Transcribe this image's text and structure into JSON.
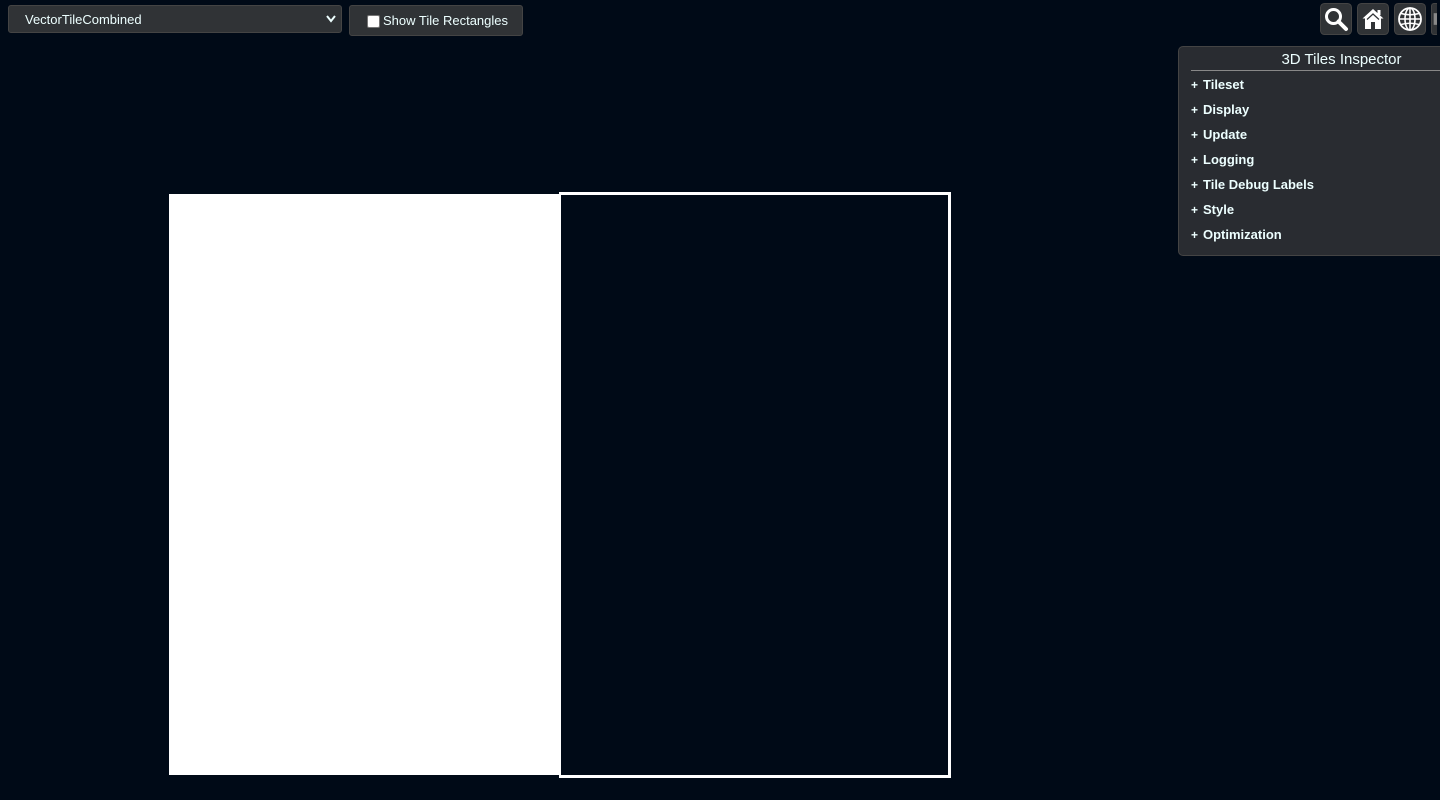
{
  "toolbar": {
    "selected_tileset": "VectorTileCombined",
    "checkbox_label": "Show Tile Rectangles",
    "checkbox_checked": false
  },
  "top_buttons": [
    {
      "name": "search-button",
      "icon": "search-icon"
    },
    {
      "name": "home-button",
      "icon": "home-icon"
    },
    {
      "name": "scene-mode-button",
      "icon": "globe-icon"
    }
  ],
  "inspector": {
    "title": "3D Tiles Inspector",
    "sections": [
      {
        "toggle": "+",
        "label": "Tileset"
      },
      {
        "toggle": "+",
        "label": "Display"
      },
      {
        "toggle": "+",
        "label": "Update"
      },
      {
        "toggle": "+",
        "label": "Logging"
      },
      {
        "toggle": "+",
        "label": "Tile Debug Labels"
      },
      {
        "toggle": "+",
        "label": "Style"
      },
      {
        "toggle": "+",
        "label": "Optimization"
      }
    ]
  },
  "colors": {
    "background": "#000a17",
    "panel": "#303336",
    "text": "#edffff",
    "tile_fill": "#ffffff"
  }
}
